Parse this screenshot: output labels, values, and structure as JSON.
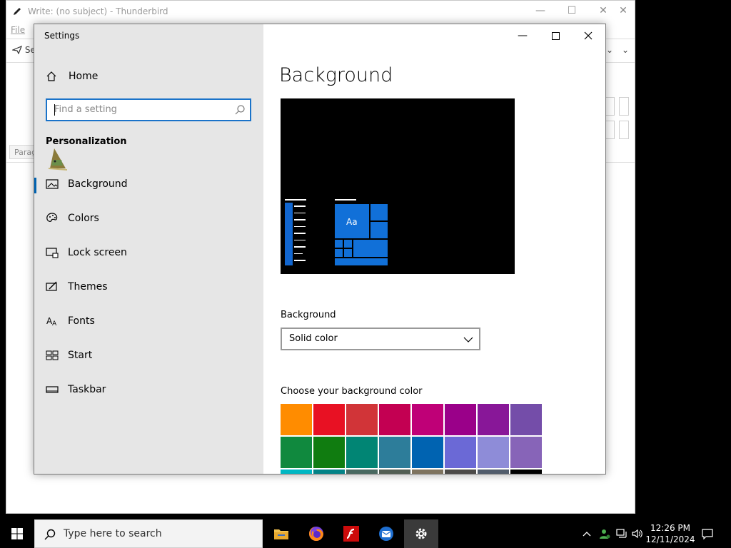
{
  "thunderbird": {
    "title": "Write: (no subject) - Thunderbird",
    "menu_file": "File",
    "send_label": "Se",
    "paragraph_label": "Parag"
  },
  "settings": {
    "window_title": "Settings",
    "home_label": "Home",
    "search_placeholder": "Find a setting",
    "section_heading": "Personalization",
    "nav_items": [
      {
        "label": "Background",
        "icon": "picture-icon",
        "selected": true
      },
      {
        "label": "Colors",
        "icon": "palette-icon",
        "selected": false
      },
      {
        "label": "Lock screen",
        "icon": "lock-screen-icon",
        "selected": false
      },
      {
        "label": "Themes",
        "icon": "themes-icon",
        "selected": false
      },
      {
        "label": "Fonts",
        "icon": "fonts-icon",
        "selected": false
      },
      {
        "label": "Start",
        "icon": "start-icon",
        "selected": false
      },
      {
        "label": "Taskbar",
        "icon": "taskbar-icon",
        "selected": false
      }
    ],
    "page_title": "Background",
    "preview_tile_text": "Aa",
    "background_label": "Background",
    "background_value": "Solid color",
    "choose_color_label": "Choose your background color",
    "color_swatches": [
      "#ff8c00",
      "#e81123",
      "#d13438",
      "#c30052",
      "#bf0077",
      "#9a0089",
      "#881798",
      "#744da9",
      "#10893e",
      "#107c10",
      "#018574",
      "#2d7d9a",
      "#0063b1",
      "#6b69d6",
      "#8e8cd8",
      "#8764b8",
      "#00b7c3",
      "#038387",
      "#486860",
      "#525e54",
      "#7e735f",
      "#4c4a48",
      "#515c6b",
      "#000000"
    ]
  },
  "taskbar": {
    "search_placeholder": "Type here to search",
    "time": "12:26 PM",
    "date": "12/11/2024"
  },
  "colors": {
    "accent": "#0063b1",
    "search_border": "#1a73c9"
  }
}
